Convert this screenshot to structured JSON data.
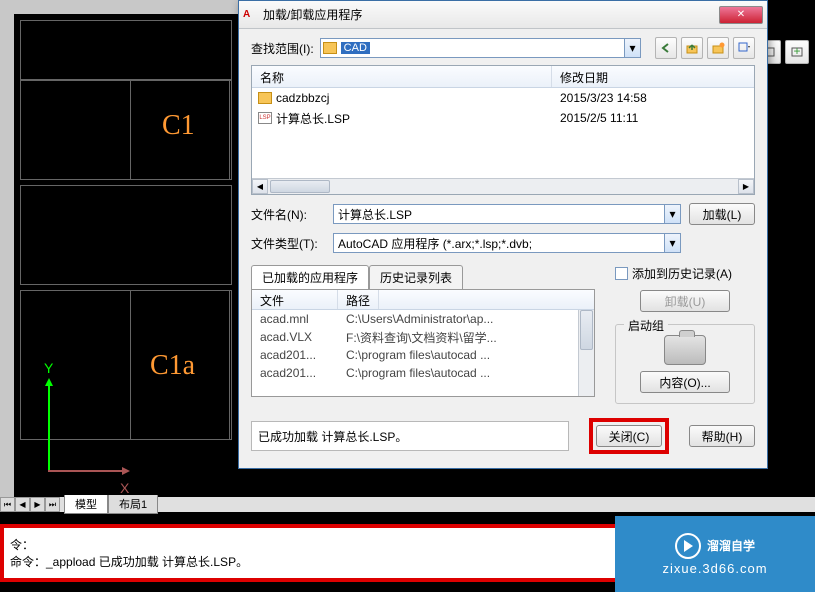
{
  "cad": {
    "label_c1": "C1",
    "label_c1a": "C1a",
    "axis_y": "Y",
    "axis_x": "X"
  },
  "tabs": {
    "model": "模型",
    "layout1": "布局1"
  },
  "cmdline": {
    "line1": "令：",
    "line2": "命令：_appload 已成功加载 计算总长.LSP。"
  },
  "dialog": {
    "title": "加载/卸载应用程序",
    "look_in_label": "查找范围(I):",
    "look_in_value": "CAD",
    "filelist": {
      "col_name": "名称",
      "col_date": "修改日期",
      "rows": [
        {
          "icon": "folder",
          "name": "cadzbbzcj",
          "date": "2015/3/23 14:58"
        },
        {
          "icon": "lsp",
          "name": "计算总长.LSP",
          "date": "2015/2/5 11:11"
        }
      ]
    },
    "filename_label": "文件名(N):",
    "filename_value": "计算总长.LSP",
    "filetype_label": "文件类型(T):",
    "filetype_value": "AutoCAD 应用程序 (*.arx;*.lsp;*.dvb;",
    "load_btn": "加载(L)",
    "tab_loaded": "已加载的应用程序",
    "tab_history": "历史记录列表",
    "loaded": {
      "col_file": "文件",
      "col_path": "路径",
      "rows": [
        {
          "f": "acad.mnl",
          "p": "C:\\Users\\Administrator\\ap..."
        },
        {
          "f": "acad.VLX",
          "p": "F:\\资料查询\\文档资料\\留学..."
        },
        {
          "f": "acad201...",
          "p": "C:\\program files\\autocad ..."
        },
        {
          "f": "acad201...",
          "p": "C:\\program files\\autocad ..."
        }
      ]
    },
    "add_history": "添加到历史记录(A)",
    "unload_btn": "卸载(U)",
    "startup_group": "启动组",
    "contents_btn": "内容(O)...",
    "status": "已成功加载 计算总长.LSP。",
    "close_btn": "关闭(C)",
    "help_btn": "帮助(H)"
  },
  "watermark": {
    "name": "溜溜自学",
    "url": "zixue.3d66.com"
  }
}
